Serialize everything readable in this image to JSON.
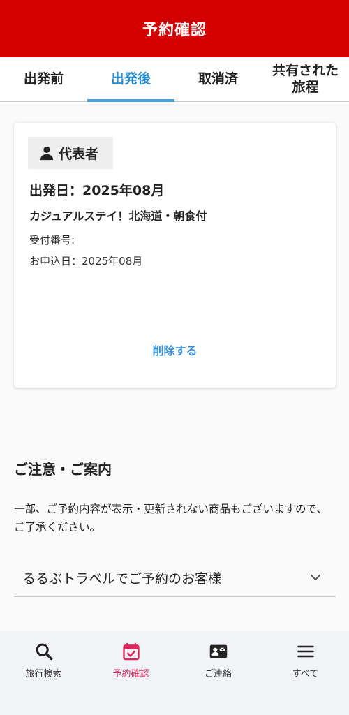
{
  "header": {
    "title": "予約確認"
  },
  "tabs": [
    {
      "label": "出発前"
    },
    {
      "label": "出発後"
    },
    {
      "label": "取消済"
    },
    {
      "label": "共有された旅程"
    }
  ],
  "card": {
    "badge_label": "代表者",
    "departure_date": "出発日：2025年08月",
    "plan_name": "カジュアルステイ！北海道・朝食付",
    "reception_number_label": "受付番号:",
    "applied_date": "お申込日：2025年08月",
    "delete_label": "削除する"
  },
  "notice": {
    "title": "ご注意・ご案内",
    "body": "一部、ご予約内容が表示・更新されない商品もございますので、ご了承ください。"
  },
  "accordion": {
    "label": "るるぶトラベルでご予約のお客様"
  },
  "bottom_nav": [
    {
      "label": "旅行検索",
      "icon": "search-icon"
    },
    {
      "label": "予約確認",
      "icon": "calendar-check-icon"
    },
    {
      "label": "ご連絡",
      "icon": "contact-card-icon"
    },
    {
      "label": "すべて",
      "icon": "menu-icon"
    }
  ],
  "colors": {
    "header_bg": "#d20000",
    "active_tab": "#2d8ecf",
    "link": "#3a8ed3",
    "nav_active": "#e0245a"
  }
}
